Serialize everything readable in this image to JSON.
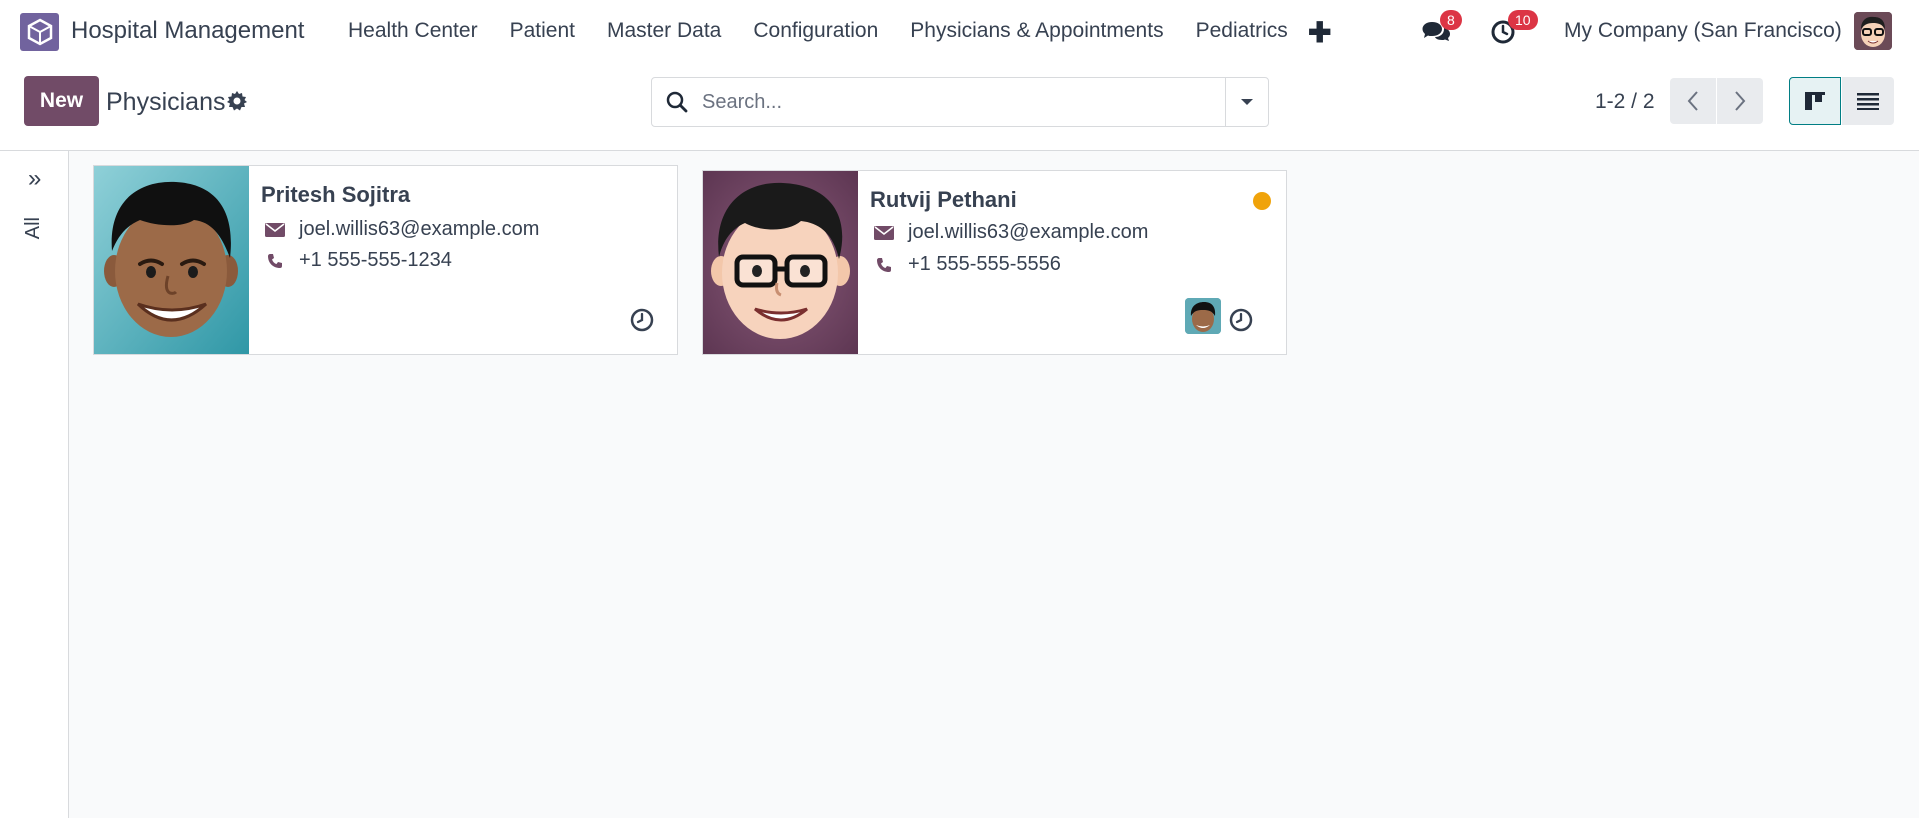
{
  "navbar": {
    "app_name": "Hospital Management",
    "menu": [
      "Health Center",
      "Patient",
      "Master Data",
      "Configuration",
      "Physicians & Appointments",
      "Pediatrics"
    ],
    "messages_count": "8",
    "activities_count": "10",
    "company": "My Company (San Francisco)"
  },
  "control": {
    "new_label": "New",
    "title": "Physicians",
    "search_placeholder": "Search...",
    "pager": "1-2 / 2"
  },
  "sidepanel": {
    "label": "All"
  },
  "cards": [
    {
      "name": "Pritesh Sojitra",
      "email": "joel.willis63@example.com",
      "phone": "+1 555-555-1234"
    },
    {
      "name": "Rutvij Pethani",
      "email": "joel.willis63@example.com",
      "phone": "+1 555-555-5556",
      "status_color": "#f0a30a"
    }
  ],
  "colors": {
    "primary": "#714b67",
    "accent": "#017e84",
    "badge": "#dc3545"
  },
  "icons": [
    "app-icon",
    "plus-icon",
    "chat-icon",
    "activity-clock-icon",
    "gear-icon",
    "search-icon",
    "caret-down-icon",
    "chevron-left-icon",
    "chevron-right-icon",
    "kanban-view-icon",
    "list-view-icon",
    "expand-icon",
    "envelope-icon",
    "phone-icon",
    "clock-icon"
  ]
}
